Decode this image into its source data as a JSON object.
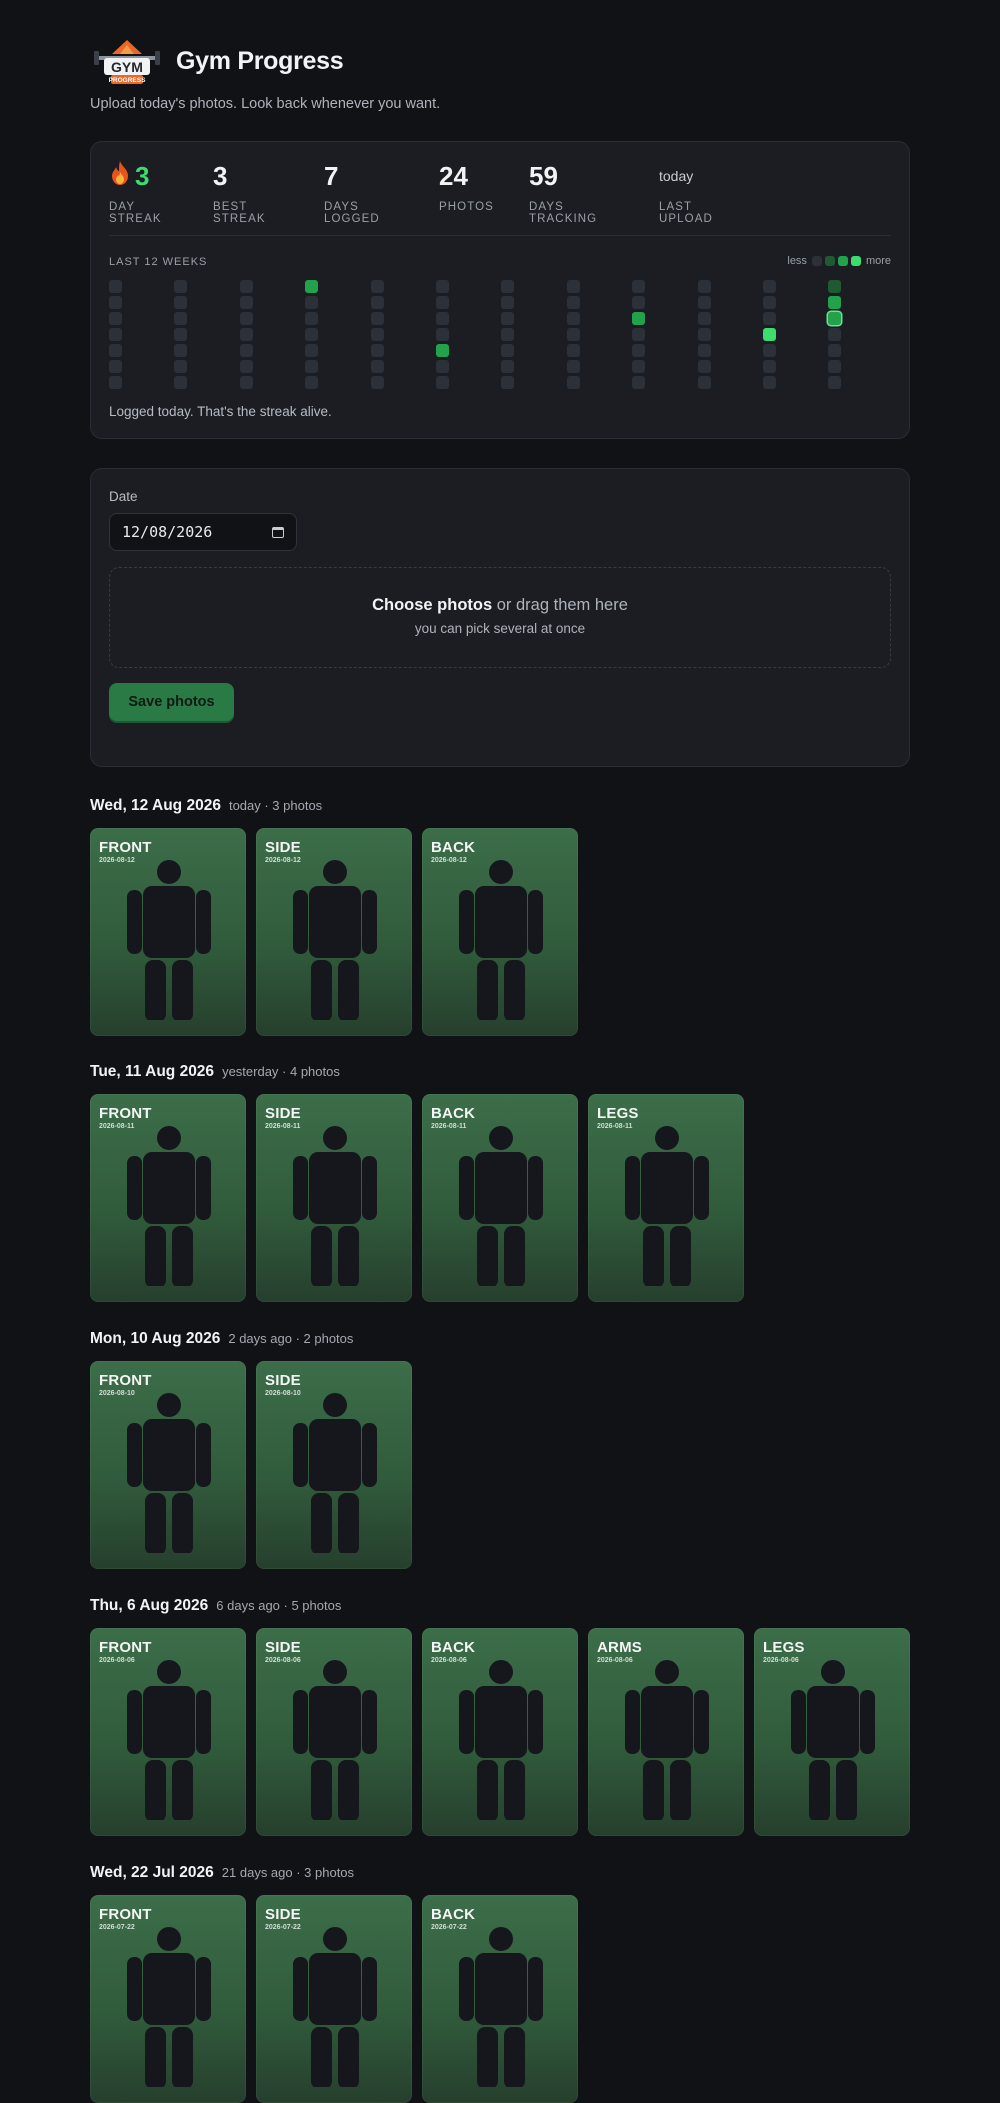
{
  "app": {
    "title": "Gym Progress",
    "subtitle": "Upload today's photos. Look back whenever you want.",
    "logo_text": "GYM",
    "logo_subtext": "PROGRESS"
  },
  "stats": [
    {
      "value": "3",
      "label": "DAY STREAK",
      "icon": "fire-icon",
      "highlight": true
    },
    {
      "value": "3",
      "label": "BEST STREAK"
    },
    {
      "value": "7",
      "label": "DAYS LOGGED"
    },
    {
      "value": "24",
      "label": "PHOTOS"
    },
    {
      "value": "59",
      "label": "DAYS TRACKING"
    },
    {
      "value": "today",
      "label": "LAST UPLOAD",
      "small": true
    }
  ],
  "heatmap": {
    "label": "LAST 12 WEEKS",
    "legend_less": "less",
    "legend_more": "more",
    "legend_colors": [
      "#2c3039",
      "#1f5a33",
      "#22a34b",
      "#3ddc6e"
    ],
    "weeks": 12,
    "rows": 7,
    "active_cells": [
      {
        "week": 3,
        "day": 0,
        "level": 2
      },
      {
        "week": 5,
        "day": 4,
        "level": 2
      },
      {
        "week": 8,
        "day": 2,
        "level": 2
      },
      {
        "week": 10,
        "day": 3,
        "level": 3
      },
      {
        "week": 11,
        "day": 0,
        "level": 1
      },
      {
        "week": 11,
        "day": 1,
        "level": 2
      },
      {
        "week": 11,
        "day": 2,
        "level": 2,
        "today": true
      }
    ],
    "message": "Logged today. That's the streak alive."
  },
  "upload": {
    "date_label": "Date",
    "date_value": "12/08/2026",
    "dropzone_strong": "Choose photos",
    "dropzone_rest": " or drag them here",
    "dropzone_sub": "you can pick several at once",
    "save_label": "Save photos"
  },
  "days": [
    {
      "title": "Wed, 12 Aug 2026",
      "meta": "today · 3 photos",
      "date": "2026-08-12",
      "photos": [
        "FRONT",
        "SIDE",
        "BACK"
      ]
    },
    {
      "title": "Tue, 11 Aug 2026",
      "meta": "yesterday · 4 photos",
      "date": "2026-08-11",
      "photos": [
        "FRONT",
        "SIDE",
        "BACK",
        "LEGS"
      ]
    },
    {
      "title": "Mon, 10 Aug 2026",
      "meta": "2 days ago · 2 photos",
      "date": "2026-08-10",
      "photos": [
        "FRONT",
        "SIDE"
      ]
    },
    {
      "title": "Thu, 6 Aug 2026",
      "meta": "6 days ago · 5 photos",
      "date": "2026-08-06",
      "photos": [
        "FRONT",
        "SIDE",
        "BACK",
        "ARMS",
        "LEGS"
      ]
    },
    {
      "title": "Wed, 22 Jul 2026",
      "meta": "21 days ago · 3 photos",
      "date": "2026-07-22",
      "photos": [
        "FRONT",
        "SIDE",
        "BACK"
      ]
    }
  ]
}
